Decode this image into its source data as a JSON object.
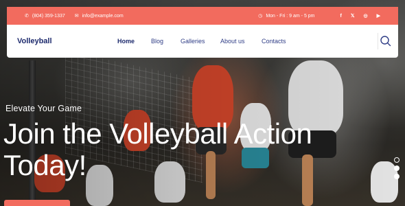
{
  "topbar": {
    "phone": "(804) 359-1337",
    "email": "info@example.com",
    "hours": "Mon - Fri : 9 am - 5 pm",
    "social": [
      {
        "icon": "facebook-icon",
        "glyph": "f"
      },
      {
        "icon": "x-icon",
        "glyph": "𝕏"
      },
      {
        "icon": "instagram-icon",
        "glyph": "◎"
      },
      {
        "icon": "youtube-icon",
        "glyph": "▶"
      }
    ],
    "accent": "#f26b5e"
  },
  "nav": {
    "logo": "Volleyball",
    "items": [
      {
        "label": "Home"
      },
      {
        "label": "Blog"
      },
      {
        "label": "Galleries"
      },
      {
        "label": "About us"
      },
      {
        "label": "Contacts"
      }
    ],
    "search_icon": "search-icon",
    "text_color": "#1d2a6d"
  },
  "hero": {
    "kicker": "Elevate Your Game",
    "headline_line1": "Join the Volleyball Action",
    "headline_line2": "Today!",
    "slides": {
      "count": 3,
      "active": 1
    }
  }
}
